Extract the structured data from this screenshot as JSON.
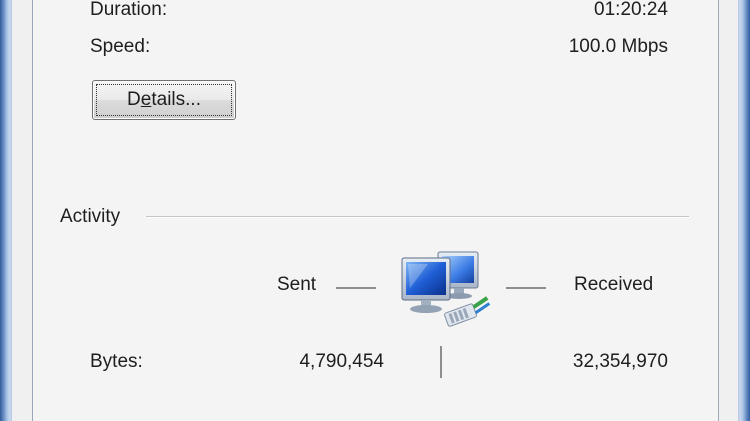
{
  "connection": {
    "duration_label": "Duration:",
    "duration_value": "01:20:24",
    "speed_label": "Speed:",
    "speed_value": "100.0 Mbps"
  },
  "details_button": {
    "label_pre": "D",
    "label_underlined": "e",
    "label_post": "tails..."
  },
  "activity": {
    "group_title": "Activity",
    "sent_label": "Sent",
    "received_label": "Received",
    "bytes_label": "Bytes:",
    "bytes_sent": "4,790,454",
    "bytes_received": "32,354,970",
    "icon": "network-computers-icon"
  },
  "colors": {
    "window_frame": "#6f93c8",
    "panel_background": "#f4f4f4"
  }
}
